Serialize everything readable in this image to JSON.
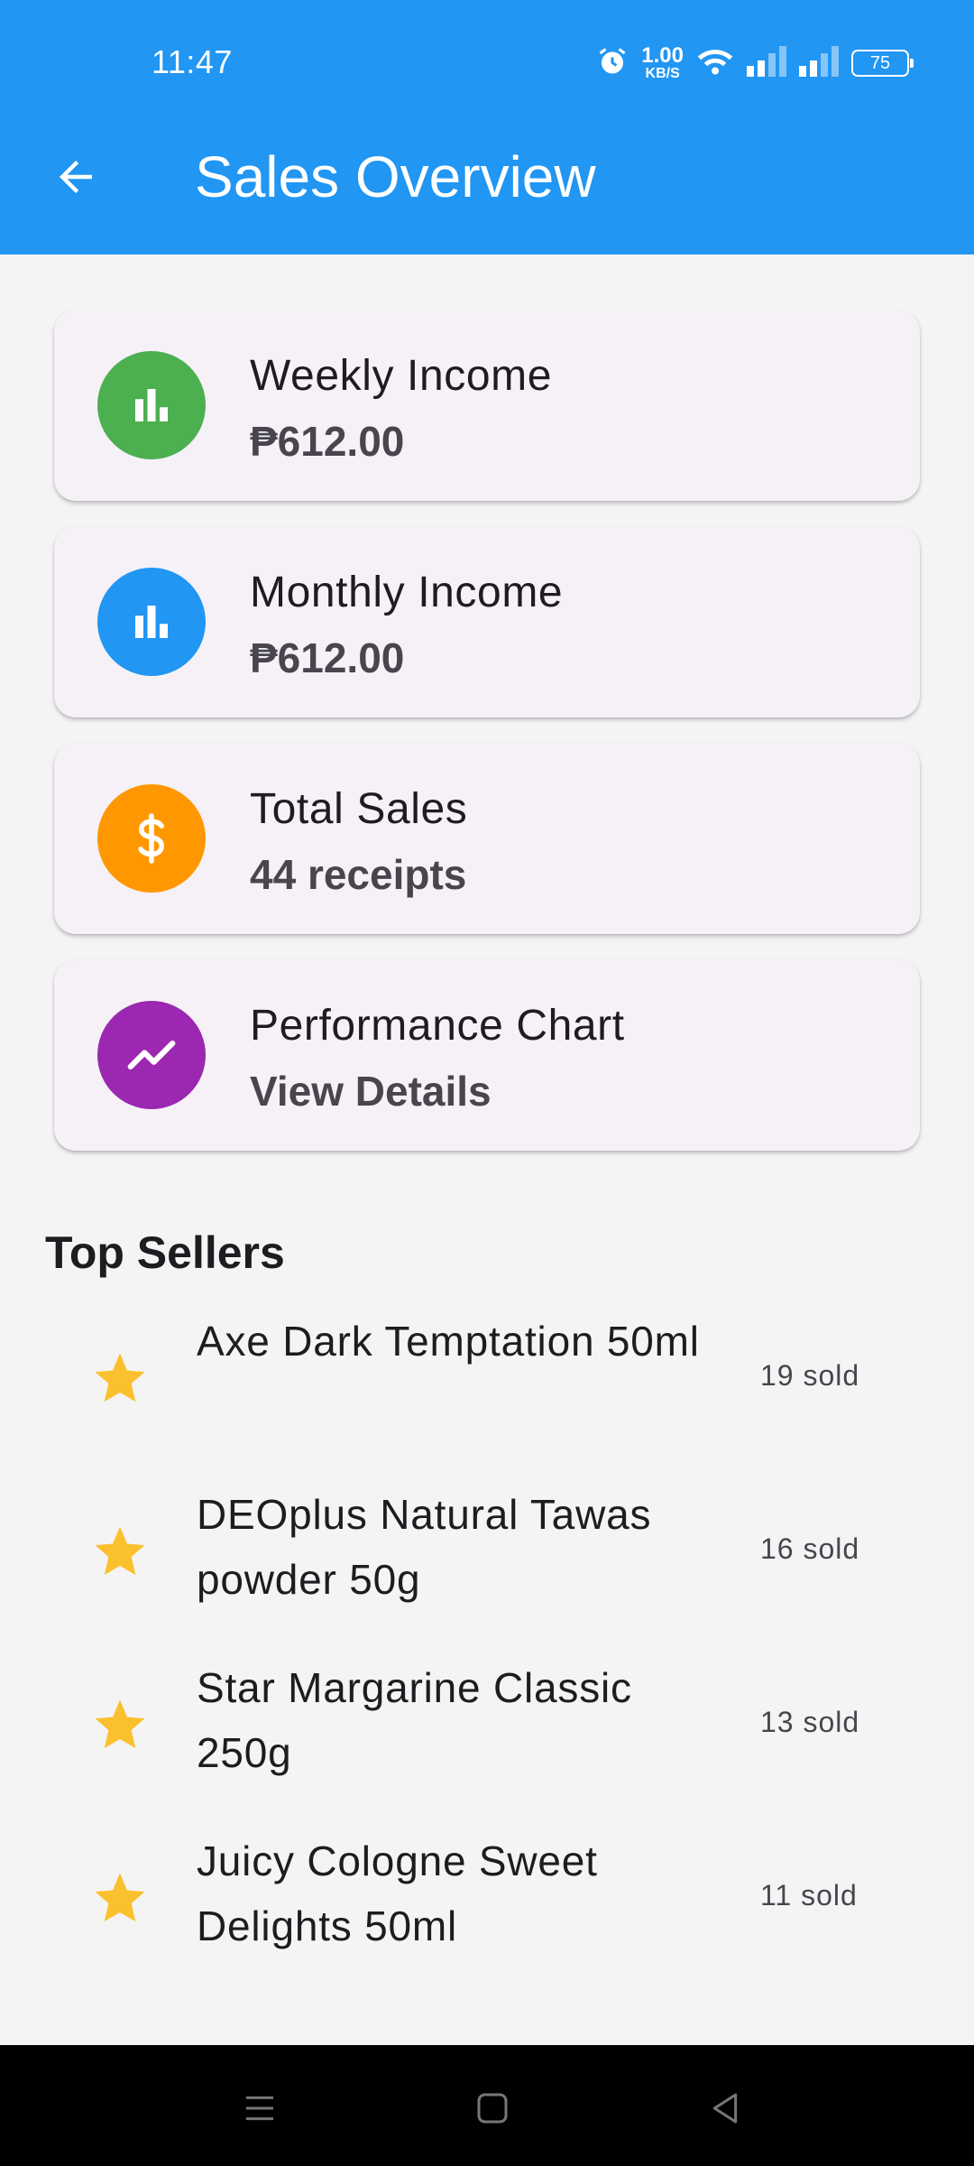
{
  "status_bar": {
    "time": "11:47",
    "net_speed_value": "1.00",
    "net_speed_unit": "KB/S",
    "battery": "75",
    "icons": [
      "alarm-icon",
      "wifi-icon",
      "signal-icon",
      "signal-icon"
    ]
  },
  "app_bar": {
    "title": "Sales Overview",
    "back_icon": "arrow-back-icon",
    "color": "#2196f3"
  },
  "cards": [
    {
      "title": "Weekly Income",
      "value": "₱612.00",
      "icon": "bar-chart-icon",
      "color": "#4caf50"
    },
    {
      "title": "Monthly Income",
      "value": "₱612.00",
      "icon": "bar-chart-icon",
      "color": "#2196f3"
    },
    {
      "title": "Total Sales",
      "value": "44 receipts",
      "icon": "dollar-icon",
      "color": "#ff9800"
    },
    {
      "title": "Performance Chart",
      "value": "View Details",
      "icon": "trending-up-icon",
      "color": "#9c27b0"
    }
  ],
  "top_sellers": {
    "title": "Top Sellers",
    "star_color": "#fbc02d",
    "items": [
      {
        "name": "Axe Dark Temptation 50ml",
        "sold": "19 sold"
      },
      {
        "name": "DEOplus Natural Tawas powder 50g",
        "sold": "16 sold"
      },
      {
        "name": "Star Margarine Classic 250g",
        "sold": "13 sold"
      },
      {
        "name": "Juicy Cologne Sweet Delights 50ml",
        "sold": "11 sold"
      }
    ]
  },
  "nav_bar": {
    "icons": [
      "menu-icon",
      "home-icon",
      "back-icon"
    ]
  }
}
